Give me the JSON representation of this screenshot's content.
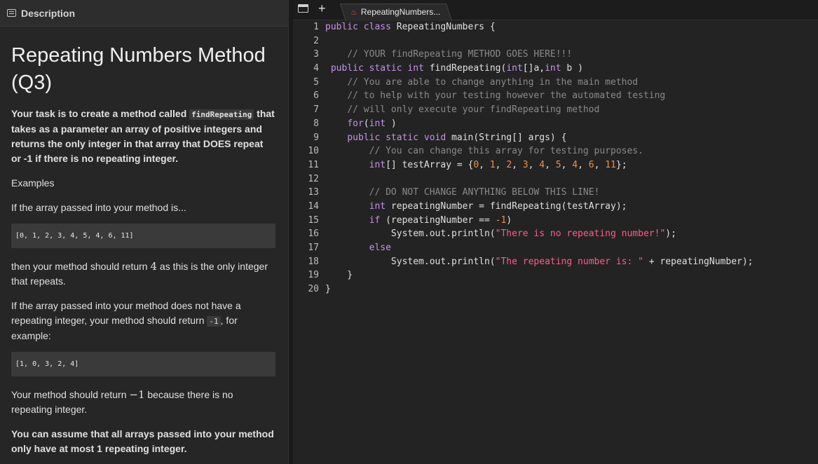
{
  "panel": {
    "header": "Description",
    "title": "Repeating Numbers Method (Q3)",
    "intro": {
      "pre": "Your task is to create a method called ",
      "code": "findRepeating",
      "post": " that takes as a parameter an array of positive integers and returns the only integer in that array that DOES repeat or -1 if there is no repeating integer."
    },
    "examples_label": "Examples",
    "if_passed": "If the array passed into your method is...",
    "example1": "[0, 1, 2, 3, 4, 5, 4, 6, 11]",
    "then_pre": "then your method should return ",
    "then_value": "4",
    "then_post": " as this is the only integer that repeats.",
    "no_repeat_pre": "If the array passed into your method does not have a repeating integer, your method should return ",
    "no_repeat_code": "-1",
    "no_repeat_post": ", for example:",
    "example2": "[1, 0, 3, 2, 4]",
    "return_pre": "Your method should return ",
    "return_value": "−1",
    "return_post": " because there is no repeating integer.",
    "assume": "You can assume that all arrays passed into your method only have at most 1 repeating integer."
  },
  "editor": {
    "tab_label": "RepeatingNumbers...",
    "icons": {
      "panel": "panel-toggle-icon",
      "new_tab": "plus-icon",
      "file": "java-file-icon"
    },
    "lines": [
      [
        [
          "kw",
          "public"
        ],
        [
          "txt",
          " "
        ],
        [
          "kw",
          "class"
        ],
        [
          "txt",
          " RepeatingNumbers {"
        ]
      ],
      [],
      [
        [
          "txt",
          "    "
        ],
        [
          "cm",
          "// YOUR findRepeating METHOD GOES HERE!!!"
        ]
      ],
      [
        [
          "txt",
          " "
        ],
        [
          "kw",
          "public"
        ],
        [
          "txt",
          " "
        ],
        [
          "kw",
          "static"
        ],
        [
          "txt",
          " "
        ],
        [
          "kw",
          "int"
        ],
        [
          "txt",
          " findRepeating("
        ],
        [
          "kw",
          "int"
        ],
        [
          "txt",
          "[]a,"
        ],
        [
          "kw",
          "int"
        ],
        [
          "txt",
          " b )"
        ]
      ],
      [
        [
          "txt",
          "    "
        ],
        [
          "cm",
          "// You are able to change anything in the main method"
        ]
      ],
      [
        [
          "txt",
          "    "
        ],
        [
          "cm",
          "// to help with your testing however the automated testing"
        ]
      ],
      [
        [
          "txt",
          "    "
        ],
        [
          "cm",
          "// will only execute your findRepeating method"
        ]
      ],
      [
        [
          "txt",
          "    "
        ],
        [
          "kw",
          "for"
        ],
        [
          "txt",
          "("
        ],
        [
          "kw",
          "int"
        ],
        [
          "txt",
          " )"
        ]
      ],
      [
        [
          "txt",
          "    "
        ],
        [
          "kw",
          "public"
        ],
        [
          "txt",
          " "
        ],
        [
          "kw",
          "static"
        ],
        [
          "txt",
          " "
        ],
        [
          "kw",
          "void"
        ],
        [
          "txt",
          " main(String[] args) {"
        ]
      ],
      [
        [
          "txt",
          "        "
        ],
        [
          "cm",
          "// You can change this array for testing purposes."
        ]
      ],
      [
        [
          "txt",
          "        "
        ],
        [
          "kw",
          "int"
        ],
        [
          "txt",
          "[] testArray = {"
        ],
        [
          "num",
          "0"
        ],
        [
          "txt",
          ", "
        ],
        [
          "num",
          "1"
        ],
        [
          "txt",
          ", "
        ],
        [
          "num",
          "2"
        ],
        [
          "txt",
          ", "
        ],
        [
          "num",
          "3"
        ],
        [
          "txt",
          ", "
        ],
        [
          "num",
          "4"
        ],
        [
          "txt",
          ", "
        ],
        [
          "num",
          "5"
        ],
        [
          "txt",
          ", "
        ],
        [
          "num",
          "4"
        ],
        [
          "txt",
          ", "
        ],
        [
          "num",
          "6"
        ],
        [
          "txt",
          ", "
        ],
        [
          "num",
          "11"
        ],
        [
          "txt",
          "};"
        ]
      ],
      [],
      [
        [
          "txt",
          "        "
        ],
        [
          "cm",
          "// DO NOT CHANGE ANYTHING BELOW THIS LINE!"
        ]
      ],
      [
        [
          "txt",
          "        "
        ],
        [
          "kw",
          "int"
        ],
        [
          "txt",
          " repeatingNumber = findRepeating(testArray);"
        ]
      ],
      [
        [
          "txt",
          "        "
        ],
        [
          "kw",
          "if"
        ],
        [
          "txt",
          " (repeatingNumber == "
        ],
        [
          "num",
          "-1"
        ],
        [
          "txt",
          ")"
        ]
      ],
      [
        [
          "txt",
          "            System.out.println("
        ],
        [
          "str",
          "\"There is no repeating number!\""
        ],
        [
          "txt",
          ");"
        ]
      ],
      [
        [
          "txt",
          "        "
        ],
        [
          "kw",
          "else"
        ]
      ],
      [
        [
          "txt",
          "            System.out.println("
        ],
        [
          "str",
          "\"The repeating number is: \""
        ],
        [
          "txt",
          " + repeatingNumber);"
        ]
      ],
      [
        [
          "txt",
          "    }"
        ]
      ],
      [
        [
          "txt",
          "}"
        ]
      ]
    ]
  }
}
